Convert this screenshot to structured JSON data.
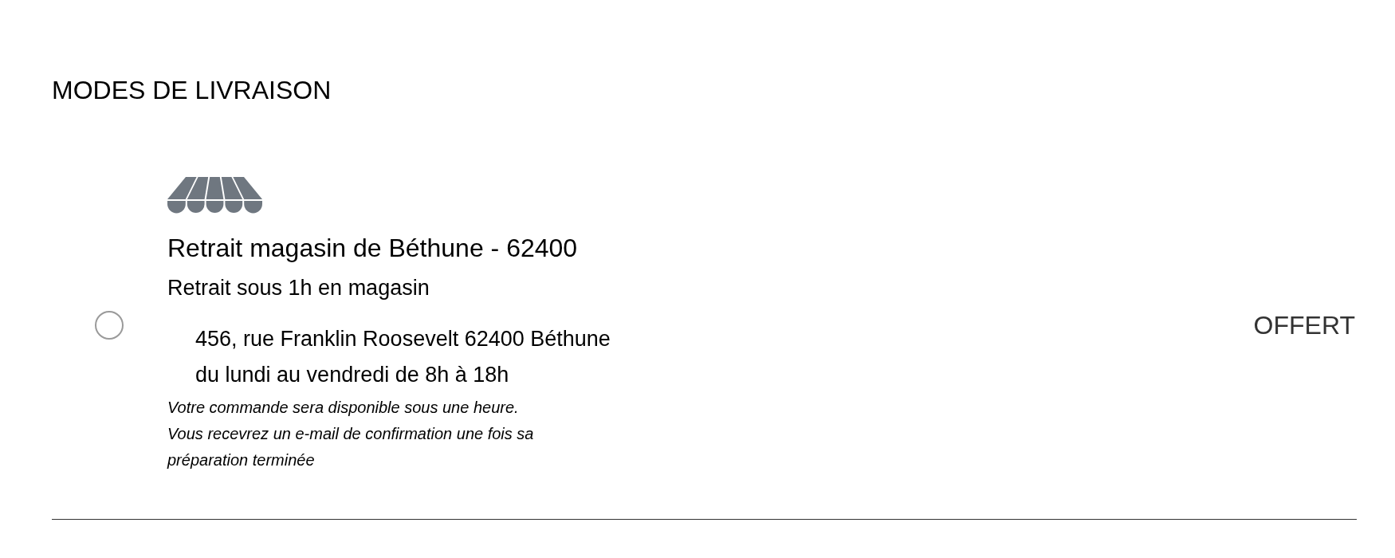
{
  "section_title": "MODES DE LIVRAISON",
  "delivery_options": [
    {
      "kind": "store_pickup",
      "selected": false,
      "title": "Retrait magasin de Béthune - 62400",
      "subtitle": "Retrait sous 1h en magasin",
      "address_lines": [
        "456, rue Franklin Roosevelt 62400 Béthune",
        "du lundi au vendredi de 8h à 18h"
      ],
      "notes": [
        "Votre commande sera disponible sous une heure.",
        "Vous recevrez un e-mail de confirmation une fois sa préparation terminée"
      ],
      "price": "OFFERT"
    }
  ]
}
